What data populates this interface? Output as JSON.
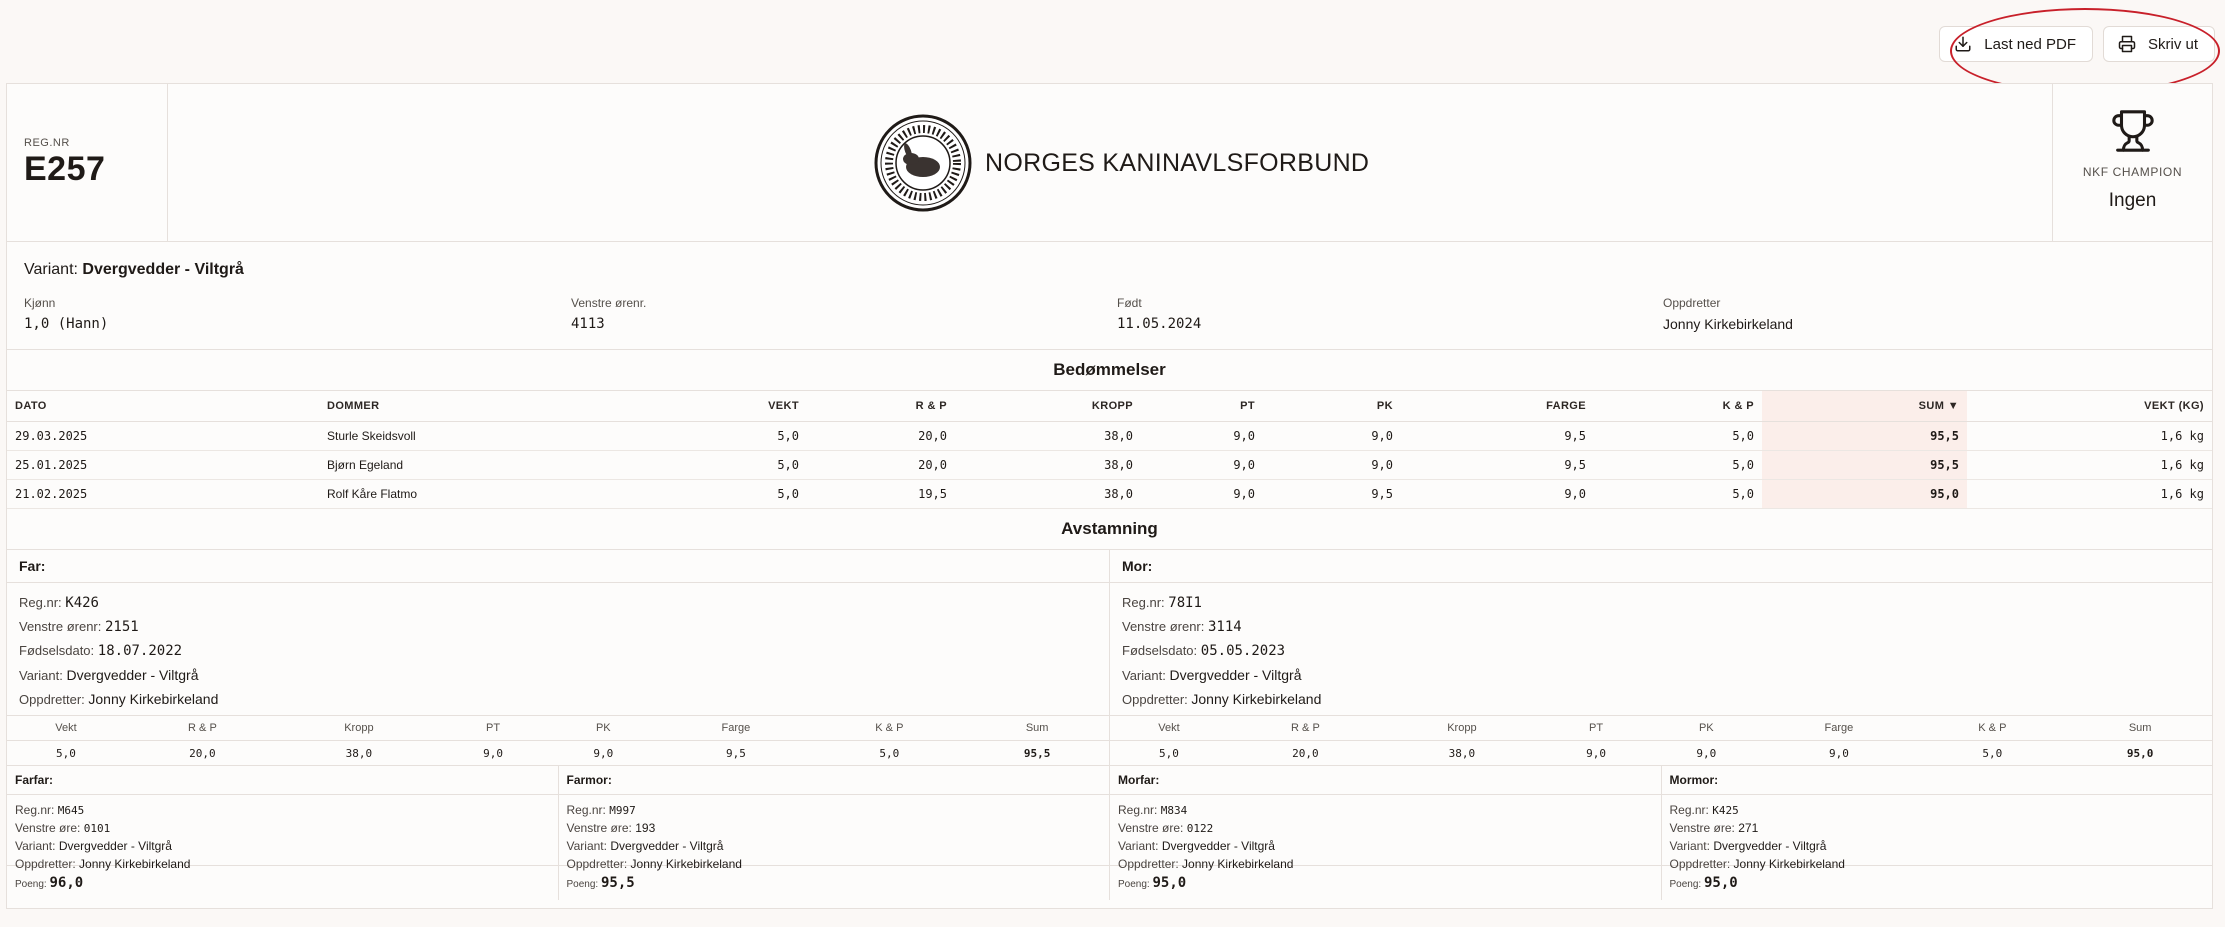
{
  "actions": {
    "download_label": "Last ned PDF",
    "print_label": "Skriv ut"
  },
  "header": {
    "reg_label": "REG.NR",
    "reg_value": "E257",
    "org_name": "NORGES KANINAVLSFORBUND",
    "champion_label": "NKF CHAMPION",
    "champion_value": "Ingen"
  },
  "info": {
    "variant_label": "Variant:",
    "variant_value": "Dvergvedder - Viltgrå",
    "fields": [
      {
        "label": "Kjønn",
        "value": "1,0 (Hann)"
      },
      {
        "label": "Venstre ørenr.",
        "value": "4113"
      },
      {
        "label": "Født",
        "value": "11.05.2024"
      },
      {
        "label": "Oppdretter",
        "value": "Jonny Kirkebirkeland"
      }
    ]
  },
  "judging": {
    "title": "Bedømmelser",
    "columns": [
      "DATO",
      "DOMMER",
      "VEKT",
      "R & P",
      "KROPP",
      "PT",
      "PK",
      "FARGE",
      "K & P",
      "SUM ▼",
      "VEKT (KG)"
    ],
    "rows": [
      [
        "29.03.2025",
        "Sturle Skeidsvoll",
        "5,0",
        "20,0",
        "38,0",
        "9,0",
        "9,0",
        "9,5",
        "5,0",
        "95,5",
        "1,6 kg"
      ],
      [
        "25.01.2025",
        "Bjørn Egeland",
        "5,0",
        "20,0",
        "38,0",
        "9,0",
        "9,0",
        "9,5",
        "5,0",
        "95,5",
        "1,6 kg"
      ],
      [
        "21.02.2025",
        "Rolf Kåre Flatmo",
        "5,0",
        "19,5",
        "38,0",
        "9,0",
        "9,5",
        "9,0",
        "5,0",
        "95,0",
        "1,6 kg"
      ]
    ]
  },
  "pedigree": {
    "title": "Avstamning",
    "labels": {
      "reg": "Reg.nr:",
      "ear": "Venstre ørenr:",
      "born": "Fødselsdato:",
      "variant": "Variant:",
      "breeder": "Oppdretter:"
    },
    "score_columns": [
      "Vekt",
      "R & P",
      "Kropp",
      "PT",
      "PK",
      "Farge",
      "K & P",
      "Sum"
    ],
    "father": {
      "heading": "Far:",
      "reg": "K426",
      "ear": "2151",
      "born": "18.07.2022",
      "variant": "Dvergvedder - Viltgrå",
      "breeder": "Jonny Kirkebirkeland",
      "scores": [
        "5,0",
        "20,0",
        "38,0",
        "9,0",
        "9,0",
        "9,5",
        "5,0",
        "95,5"
      ]
    },
    "mother": {
      "heading": "Mor:",
      "reg": "78I1",
      "ear": "3114",
      "born": "05.05.2023",
      "variant": "Dvergvedder - Viltgrå",
      "breeder": "Jonny Kirkebirkeland",
      "scores": [
        "5,0",
        "20,0",
        "38,0",
        "9,0",
        "9,0",
        "9,0",
        "5,0",
        "95,0"
      ]
    },
    "grand_labels": {
      "reg": "Reg.nr:",
      "ear": "Venstre øre:",
      "variant": "Variant:",
      "breeder": "Oppdretter:",
      "points": "Poeng:"
    },
    "grandparents": [
      {
        "heading": "Farfar:",
        "reg": "M645",
        "ear": "0101",
        "variant": "Dvergvedder - Viltgrå",
        "breeder": "Jonny Kirkebirkeland",
        "points": "96,0"
      },
      {
        "heading": "Farmor:",
        "reg": "M997",
        "ear": "193",
        "variant": "Dvergvedder - Viltgrå",
        "breeder": "Jonny Kirkebirkeland",
        "points": "95,5"
      },
      {
        "heading": "Morfar:",
        "reg": "M834",
        "ear": "0122",
        "variant": "Dvergvedder - Viltgrå",
        "breeder": "Jonny Kirkebirkeland",
        "points": "95,0"
      },
      {
        "heading": "Mormor:",
        "reg": "K425",
        "ear": "271",
        "variant": "Dvergvedder - Viltgrå",
        "breeder": "Jonny Kirkebirkeland",
        "points": "95,0"
      }
    ]
  },
  "colors": {
    "accent_sum_bg": "#fbeeea",
    "annotation": "#c8202a",
    "border": "#e6e0dc"
  },
  "icons": [
    "download-icon",
    "printer-icon",
    "trophy-icon",
    "seal-logo"
  ]
}
